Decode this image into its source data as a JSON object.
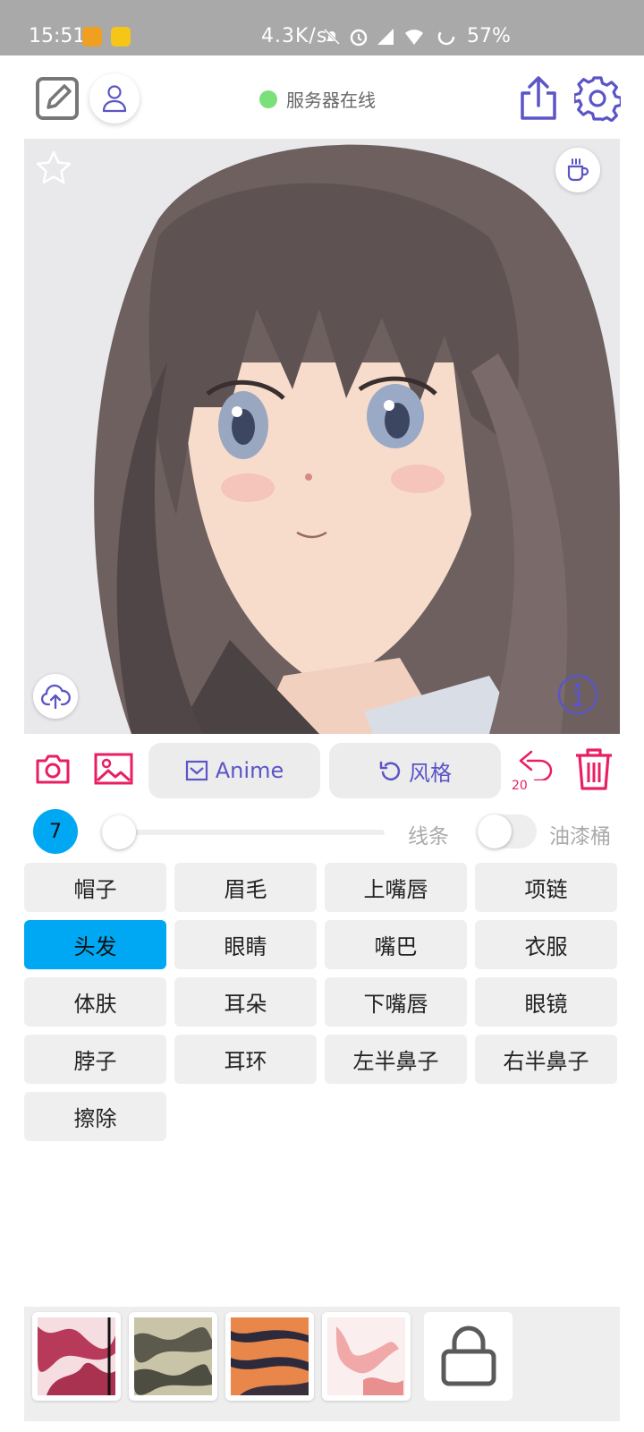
{
  "status_bar": {
    "time": "15:51",
    "network_speed": "4.3K/s",
    "battery": "57%"
  },
  "header": {
    "server_status": "服务器在线",
    "status_color": "#7ce07a",
    "accent_color": "#5b55c7"
  },
  "actions": {
    "anime_label": "Anime",
    "style_label": "风格",
    "undo_count": "20"
  },
  "brush": {
    "size": "7",
    "size_level": 0.0,
    "line_label": "线条",
    "bucket_label": "油漆桶",
    "bucket_enabled": false
  },
  "parts": {
    "selected": "头发",
    "items": [
      "帽子",
      "眉毛",
      "上嘴唇",
      "项链",
      "头发",
      "眼睛",
      "嘴巴",
      "衣服",
      "体肤",
      "耳朵",
      "下嘴唇",
      "眼镜",
      "脖子",
      "耳环",
      "左半鼻子",
      "右半鼻子",
      "擦除"
    ]
  },
  "icons": {
    "edit": "edit-square-icon",
    "user": "user-icon",
    "share": "share-icon",
    "settings": "gear-icon",
    "favorite": "star-icon",
    "cup": "coffee-cup-icon",
    "upload": "cloud-upload-icon",
    "info": "info-icon",
    "camera": "camera-icon",
    "gallery": "image-icon",
    "undo": "undo-icon",
    "delete": "trash-icon",
    "store": "shopping-bag-icon"
  }
}
